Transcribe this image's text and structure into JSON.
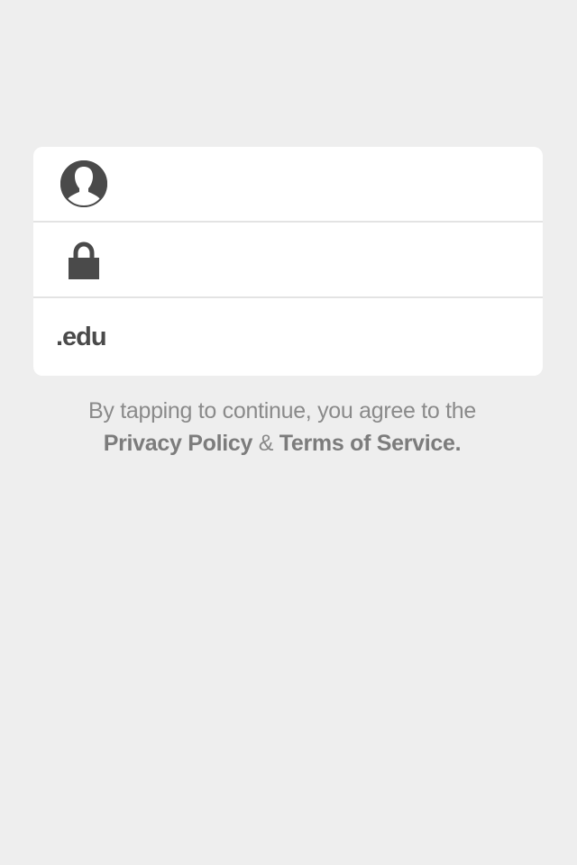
{
  "form": {
    "username_placeholder": "",
    "password_placeholder": "",
    "domain_label": ".edu",
    "domain_placeholder": ""
  },
  "icons": {
    "username": "user-silhouette-icon",
    "password": "padlock-icon"
  },
  "legal": {
    "prefix": "By tapping to continue, you agree to the",
    "privacy_link": "Privacy Policy",
    "ampersand": "&",
    "terms_link": "Terms of Service",
    "suffix": "."
  },
  "colors": {
    "background": "#eeeeee",
    "card": "#ffffff",
    "icon": "#4a4a4a",
    "text": "#8a8a8a"
  }
}
